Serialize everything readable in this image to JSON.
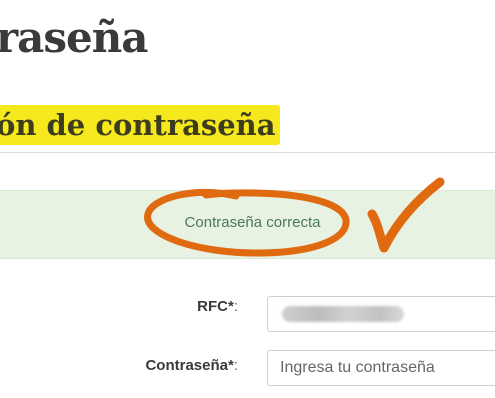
{
  "header": {
    "title": "raseña",
    "section_title": "ón de contraseña"
  },
  "alert": {
    "message": "Contraseña correcta",
    "color": "#4d7a55",
    "background": "#e7f2e2"
  },
  "annotation": {
    "color": "#e06a10",
    "shapes": [
      "circle-around-message",
      "checkmark"
    ]
  },
  "form": {
    "rfc_label": "RFC*",
    "rfc_colon": ":",
    "rfc_value": "",
    "password_label": "Contraseña*",
    "password_colon": ":",
    "password_placeholder": "Ingresa tu contraseña"
  },
  "colors": {
    "highlight": "#f5e81c",
    "title_text": "#3a3a3a"
  }
}
